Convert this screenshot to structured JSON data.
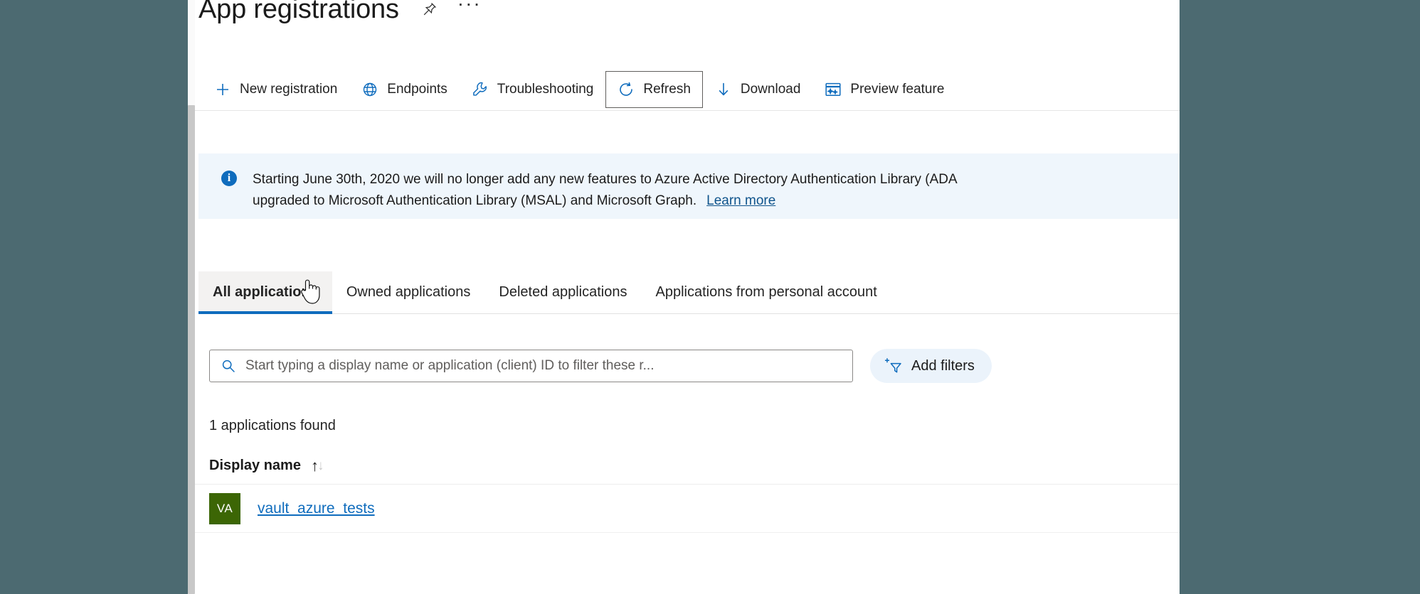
{
  "header": {
    "title": "App registrations",
    "pin_icon": "pin-icon",
    "more_icon": "ellipsis-icon"
  },
  "toolbar": {
    "items": [
      {
        "label": "New registration",
        "icon": "plus-icon",
        "focused": false
      },
      {
        "label": "Endpoints",
        "icon": "globe-icon",
        "focused": false
      },
      {
        "label": "Troubleshooting",
        "icon": "wrench-icon",
        "focused": false
      },
      {
        "label": "Refresh",
        "icon": "refresh-icon",
        "focused": true
      },
      {
        "label": "Download",
        "icon": "download-arrow-icon",
        "focused": false
      },
      {
        "label": "Preview feature",
        "icon": "preview-features-icon",
        "focused": false
      }
    ]
  },
  "banner": {
    "icon": "info-icon",
    "line1": "Starting June 30th, 2020 we will no longer add any new features to Azure Active Directory Authentication Library (ADA",
    "line2": "upgraded to Microsoft Authentication Library (MSAL) and Microsoft Graph.",
    "link": "Learn more"
  },
  "tabs": [
    {
      "label": "All applications",
      "active": true
    },
    {
      "label": "Owned applications",
      "active": false
    },
    {
      "label": "Deleted applications",
      "active": false
    },
    {
      "label": "Applications from personal account",
      "active": false
    }
  ],
  "search": {
    "icon": "search-icon",
    "placeholder": "Start typing a display name or application (client) ID to filter these r...",
    "value": ""
  },
  "add_filters": {
    "label": "Add filters",
    "icon": "add-filter-icon"
  },
  "results": {
    "count_text": "1 applications found",
    "columns": [
      {
        "label": "Display name",
        "sortable": true,
        "sort_icon": "sort-ascending-icon"
      }
    ],
    "rows": [
      {
        "avatar_initials": "VA",
        "avatar_color": "#3C6605",
        "display_name": "vault_azure_tests"
      }
    ]
  },
  "colors": {
    "accent": "#0f6cbd",
    "banner_bg": "#eff6fc",
    "active_tab_bg": "#f3f2f1",
    "page_bg": "#4C6A71",
    "link": "#0f6cbd"
  },
  "cursor": {
    "type": "pointing-hand-cursor"
  }
}
